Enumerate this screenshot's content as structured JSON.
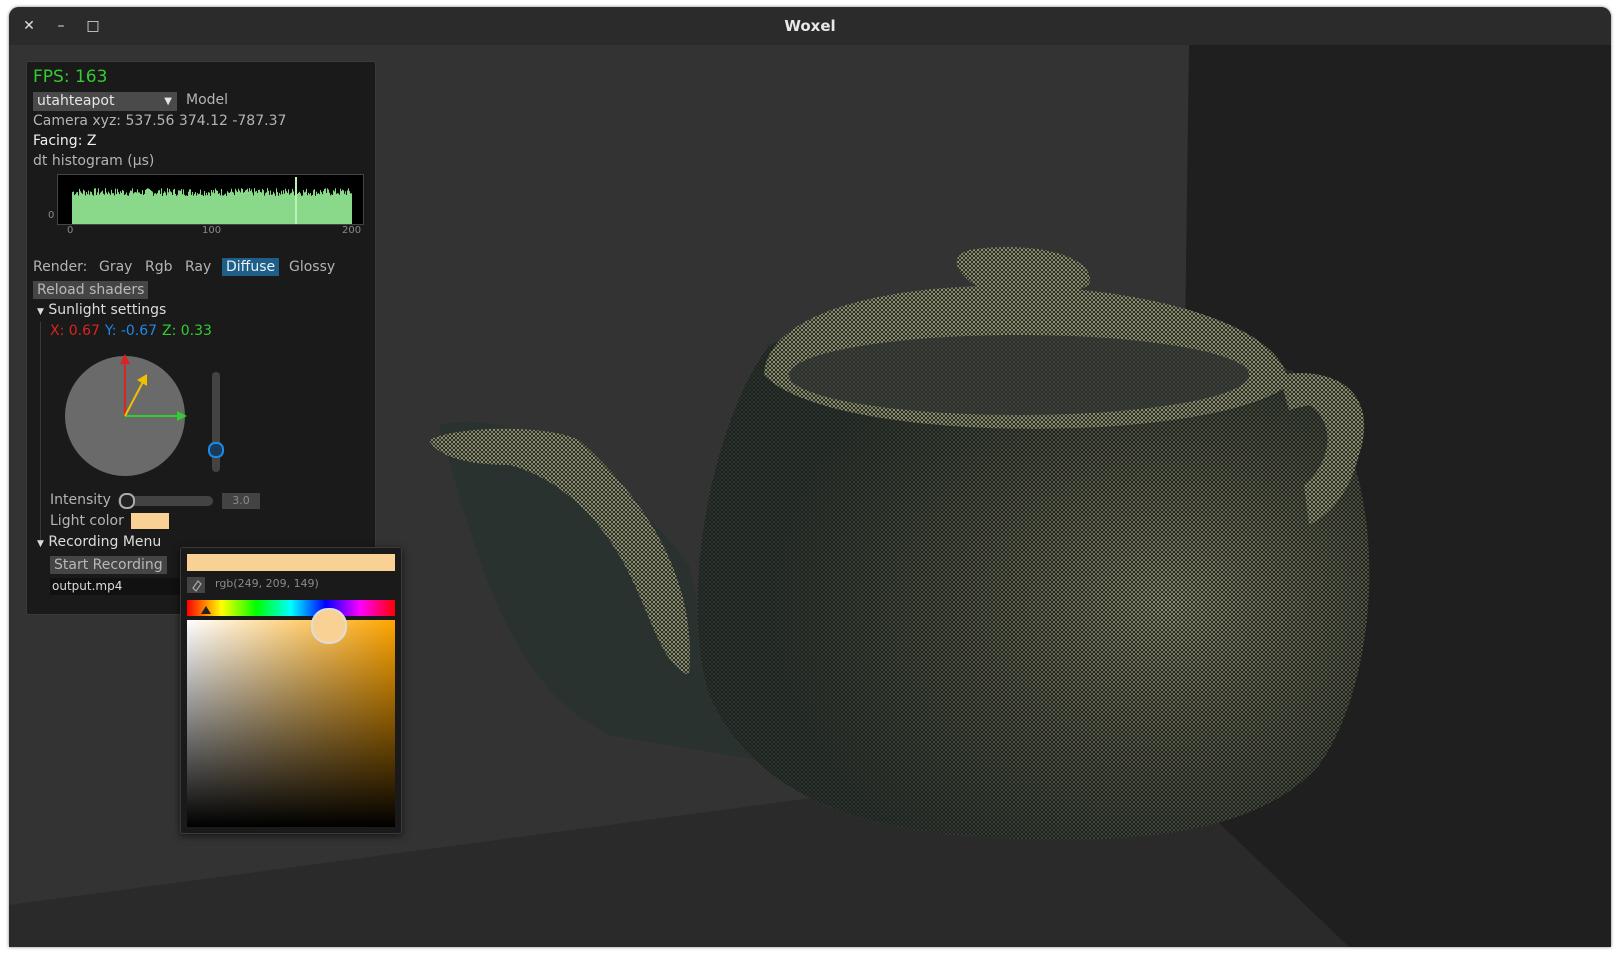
{
  "window": {
    "title": "Woxel",
    "close_glyph": "✕",
    "minimize_glyph": "–",
    "maximize_glyph": "□"
  },
  "panel": {
    "fps": "FPS: 163",
    "model_select": {
      "value": "utahteapot",
      "label": "Model"
    },
    "camera": "Camera xyz: 537.56 374.12 -787.37",
    "facing": "Facing:  Z",
    "histogram": {
      "label": "dt histogram (μs)",
      "y_tick": "0",
      "x_ticks": [
        "0",
        "100",
        "200"
      ]
    },
    "render": {
      "label": "Render:",
      "modes": [
        "Gray",
        "Rgb",
        "Ray",
        "Diffuse",
        "Glossy"
      ],
      "selected": "Diffuse"
    },
    "reload_button": "Reload shaders",
    "sunlight": {
      "header": "Sunlight settings",
      "x": "X: 0.67",
      "y": "Y: -0.67",
      "z": "Z: 0.33",
      "intensity_label": "Intensity",
      "intensity_value": "3.0",
      "intensity_fraction": 0.05,
      "elevation_fraction": 0.22,
      "light_color_label": "Light color",
      "light_color": "#f9d195"
    },
    "recording": {
      "header": "Recording Menu",
      "start_button": "Start Recording",
      "filename": "output.mp4"
    }
  },
  "color_picker": {
    "preview": "#f9d195",
    "rgb_text": "rgb(249, 209, 149)",
    "hue_color": "#ffa500"
  },
  "colors": {
    "accent": "#1e5f88",
    "fps_green": "#33cc33",
    "hist_bar": "#8ad88a",
    "axis_x": "#dd2222",
    "axis_y": "#1e88e5",
    "axis_z": "#33cc33",
    "voxel": "#8c8c6a"
  }
}
